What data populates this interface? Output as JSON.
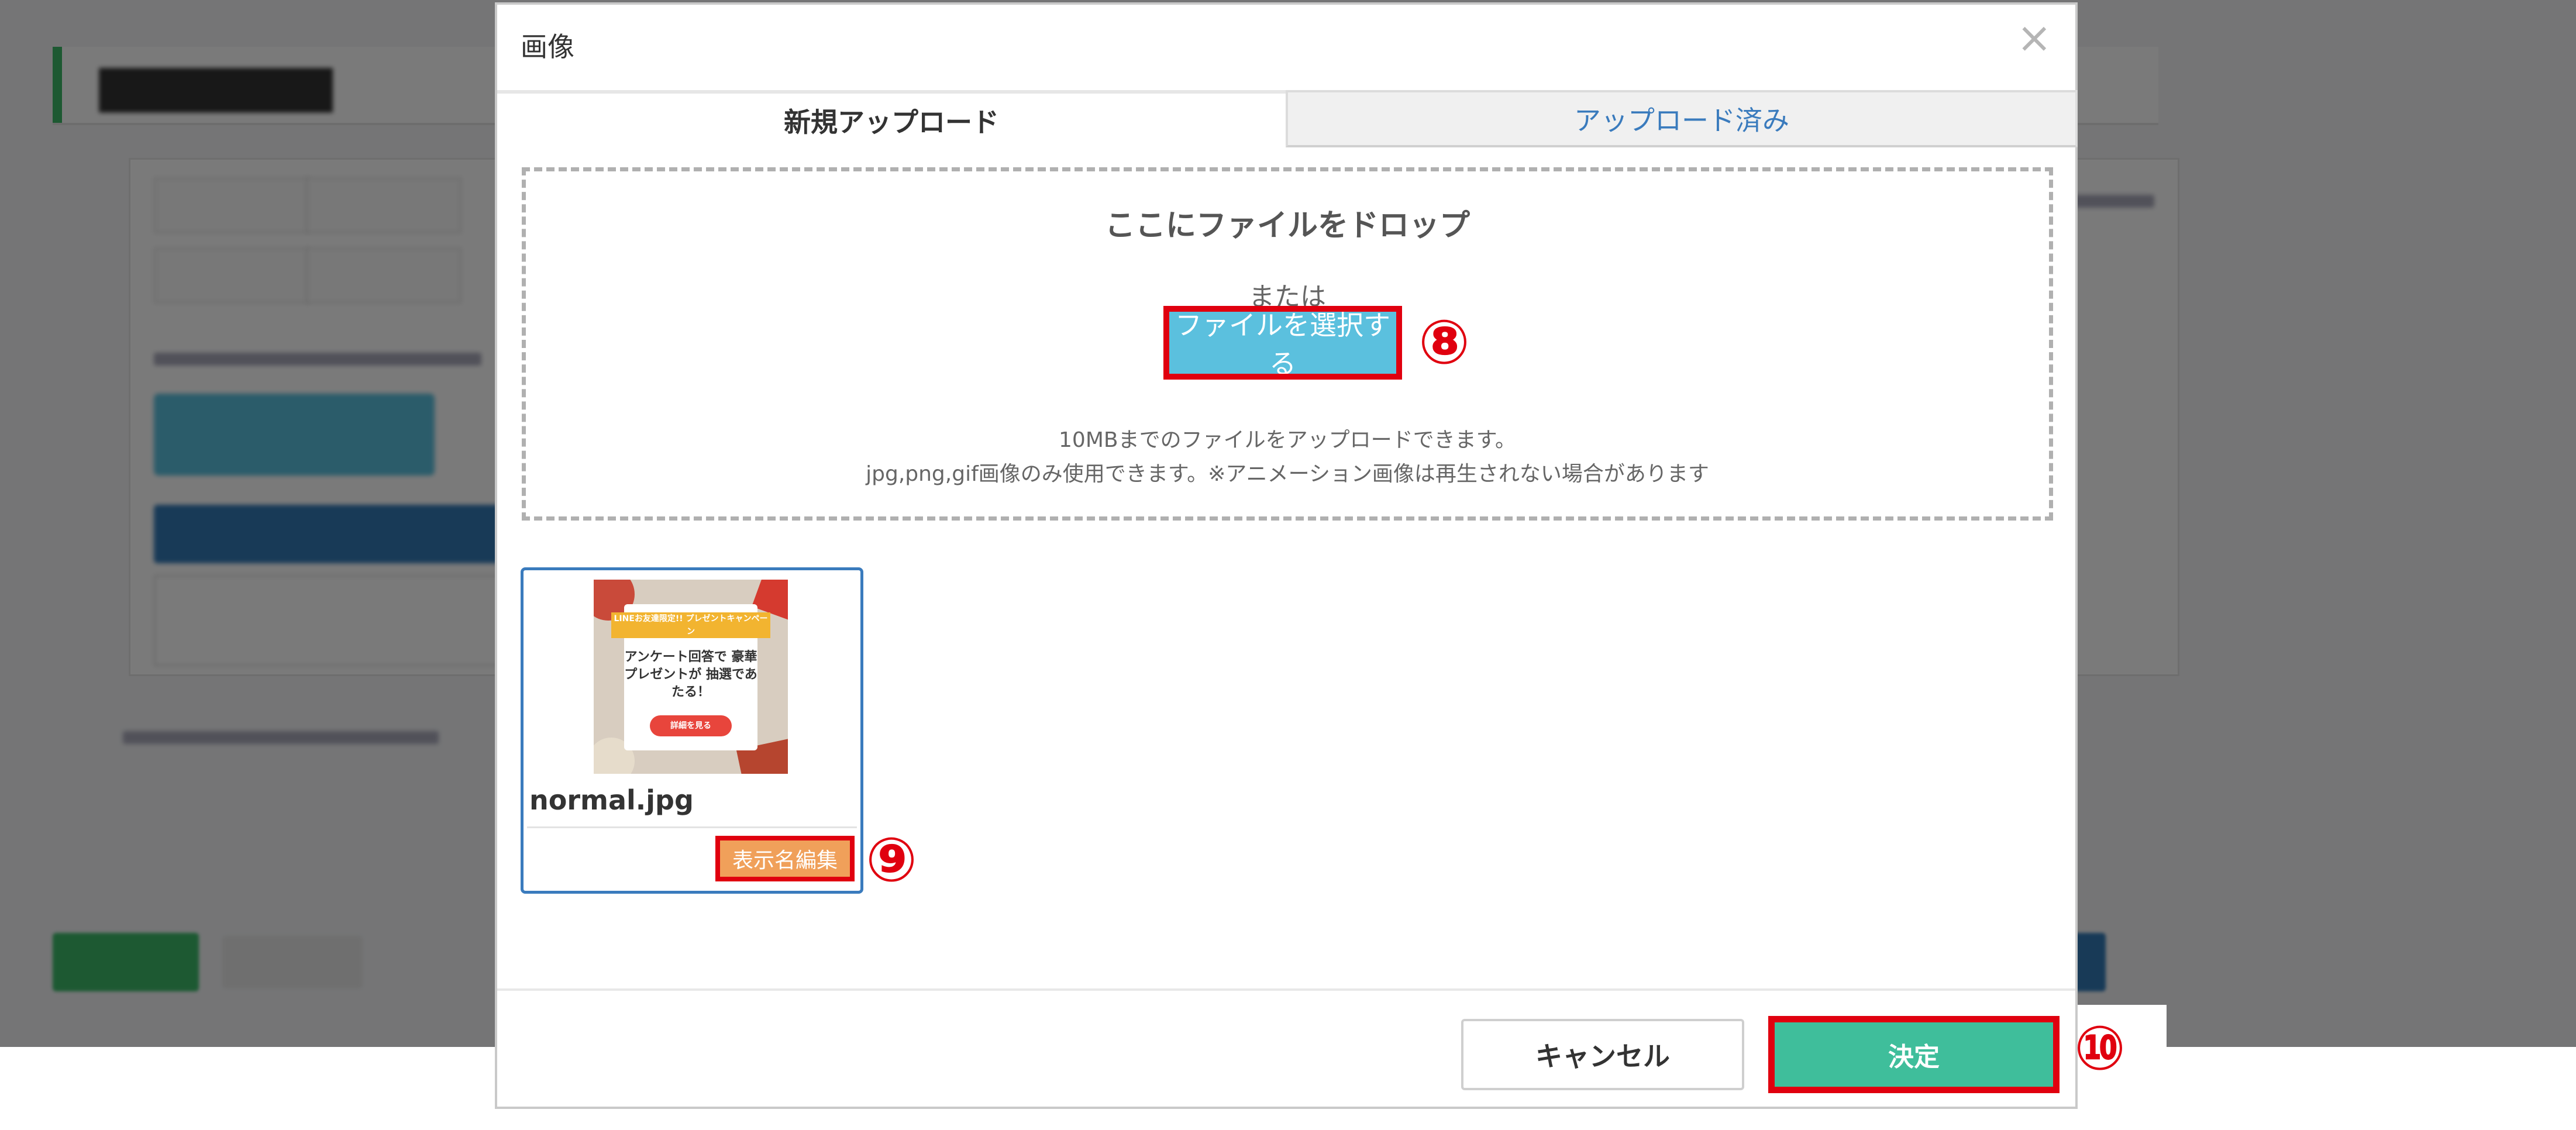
{
  "modal": {
    "title": "画像",
    "close_icon": "close-icon",
    "tabs": [
      {
        "label": "新規アップロード",
        "active": true
      },
      {
        "label": "アップロード済み",
        "active": false
      }
    ],
    "dropzone": {
      "title": "ここにファイルをドロップ",
      "or_text": "または",
      "select_button": "ファイルを選択する",
      "note_size": "10MBまでのファイルをアップロードできます。",
      "note_types": "jpg,png,gif画像のみ使用できます。※アニメーション画像は再生されない場合があります"
    },
    "file": {
      "name": "normal.jpg",
      "rename_button": "表示名編集",
      "thumbnail": {
        "ribbon_text": "LINEお友達限定!! プレゼントキャンペーン",
        "body_text": "アンケート回答で 豪華プレゼントが 抽選であたる！",
        "pill_text": "詳細を見る"
      }
    },
    "footer": {
      "cancel_button": "キャンセル",
      "ok_button": "決定"
    }
  },
  "markers": [
    "⑧",
    "⑨",
    "⑩"
  ],
  "colors": {
    "select_button": "#5bc0de",
    "rename_button": "#f0a05a",
    "ok_button": "#3fbe9b",
    "tab_link": "#3a7bbd",
    "highlight_border": "#e0000f"
  }
}
